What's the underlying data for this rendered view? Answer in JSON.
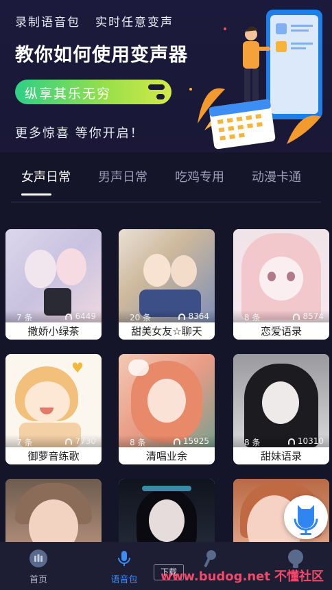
{
  "banner": {
    "line1_a": "录制语音包",
    "line1_b": "实时任意变声",
    "title": "教你如何使用变声器",
    "pill": "纵享其乐无穷",
    "subtitle": "更多惊喜 等你开启！"
  },
  "tabs": [
    {
      "label": "女声日常",
      "active": true
    },
    {
      "label": "男声日常",
      "active": false
    },
    {
      "label": "吃鸡专用",
      "active": false
    },
    {
      "label": "动漫卡通",
      "active": false
    }
  ],
  "cards": [
    {
      "name": "撒娇小绿茶",
      "count": "7 条",
      "plays": "6449"
    },
    {
      "name": "甜美女友☆聊天",
      "count": "20 条",
      "plays": "8364"
    },
    {
      "name": "恋爱语录",
      "count": "8 条",
      "plays": "8574"
    },
    {
      "name": "御萝音练歌",
      "count": "7 条",
      "plays": "7730"
    },
    {
      "name": "清唱业余",
      "count": "8 条",
      "plays": "15925"
    },
    {
      "name": "甜妹语录",
      "count": "8 条",
      "plays": "10310"
    }
  ],
  "nav": [
    {
      "label": "首页",
      "icon": "home-icon",
      "active": false
    },
    {
      "label": "语音包",
      "icon": "microphone-icon",
      "active": true
    },
    {
      "label": "",
      "icon": "mic-stand-icon",
      "active": false
    },
    {
      "label": "",
      "icon": "profile-icon",
      "active": false
    }
  ],
  "download_label": "下载",
  "watermark": {
    "url": "www.budog.net",
    "text": "不懂社区"
  },
  "colors": {
    "background": "#15152a",
    "accent": "#3c8ef5",
    "pill_start": "#2ecf86",
    "pill_end": "#d4e94a",
    "watermark": "#f24a6a"
  }
}
